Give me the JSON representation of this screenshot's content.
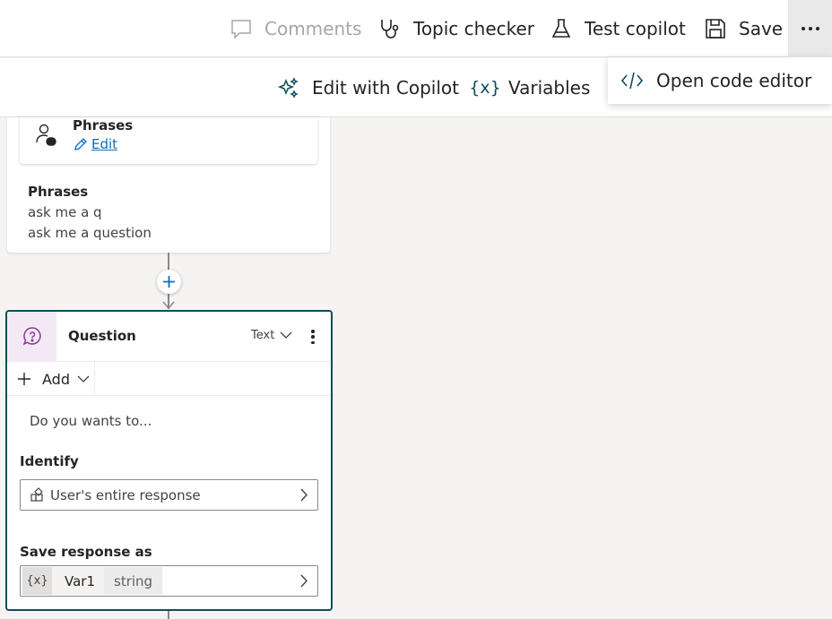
{
  "toolbar": {
    "comments_label": "Comments",
    "topic_checker_label": "Topic checker",
    "test_copilot_label": "Test copilot",
    "save_label": "Save",
    "more_icon": "ellipsis-icon"
  },
  "subtoolbar": {
    "edit_with_copilot_label": "Edit with Copilot",
    "variables_label": "Variables"
  },
  "menu": {
    "items": [
      {
        "label": "Open code editor",
        "icon": "code-icon"
      }
    ]
  },
  "trigger": {
    "title": "Phrases",
    "edit_label": "Edit",
    "phrases_heading": "Phrases",
    "phrases": [
      "ask me a q",
      "ask me a question"
    ]
  },
  "question": {
    "title": "Question",
    "type_label": "Text",
    "add_label": "Add",
    "prompt": "Do you wants to...",
    "identify_label": "Identify",
    "identify_value": "User's entire response",
    "save_label": "Save response as",
    "var_icon": "{x}",
    "var_name": "Var1",
    "var_type": "string"
  },
  "colors": {
    "accent": "#0f6cbd",
    "card_border": "#0e4d5c",
    "question_icon_bg": "#f3e9f5",
    "question_icon": "#8a3a8f"
  }
}
